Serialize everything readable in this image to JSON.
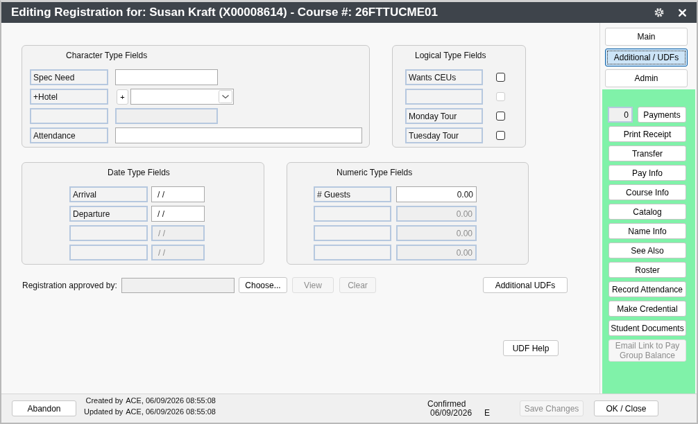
{
  "window": {
    "title": "Editing Registration for: Susan Kraft (X00008614) - Course #: 26FTTUCME01"
  },
  "groups": [
    {
      "kind": "character",
      "title": "Character Type Fields",
      "rows": [
        {
          "kind": "text",
          "label": "Spec Need",
          "disabled": false
        },
        {
          "kind": "lookup",
          "label": "+Hotel",
          "add_button": "+",
          "disabled": false
        },
        {
          "kind": "text",
          "disabled": true
        },
        {
          "kind": "long_text",
          "label": "Attendance",
          "disabled": false
        }
      ]
    },
    {
      "kind": "logical",
      "title": "Logical Type Fields",
      "rows": [
        {
          "kind": "checkbox",
          "label": "Wants CEUs",
          "checked": false,
          "disabled": false
        },
        {
          "kind": "checkbox",
          "checked": false,
          "disabled": true
        },
        {
          "kind": "checkbox",
          "label": "Monday Tour",
          "checked": false,
          "disabled": false
        },
        {
          "kind": "checkbox",
          "label": "Tuesday Tour",
          "checked": false,
          "disabled": false
        }
      ]
    },
    {
      "kind": "date",
      "title": "Date Type Fields",
      "rows": [
        {
          "kind": "date",
          "label": "Arrival",
          "value": "/ /",
          "disabled": false
        },
        {
          "kind": "date",
          "label": "Departure",
          "value": "/ /",
          "disabled": false
        },
        {
          "kind": "date",
          "value": "/ /",
          "disabled": true
        },
        {
          "kind": "date",
          "value": "/ /",
          "disabled": true
        }
      ]
    },
    {
      "kind": "numeric",
      "title": "Numeric Type Fields",
      "rows": [
        {
          "kind": "numeric",
          "label": "# Guests",
          "value": "0.00",
          "disabled": false
        },
        {
          "kind": "numeric",
          "value": "0.00",
          "disabled": true
        },
        {
          "kind": "numeric",
          "value": "0.00",
          "disabled": true
        },
        {
          "kind": "numeric",
          "value": "0.00",
          "disabled": true
        }
      ]
    }
  ],
  "approval": {
    "label": "Registration approved by:",
    "field_disabled": true,
    "buttons": [
      {
        "label": "Choose...",
        "disabled": false
      },
      {
        "label": "View",
        "disabled": true
      },
      {
        "label": "Clear",
        "disabled": true
      }
    ]
  },
  "additional_udfs_button": "Additional UDFs",
  "udf_help_button": "UDF Help",
  "side_tabs": [
    {
      "label": "Main",
      "selected": false
    },
    {
      "label": "Additional / UDFs",
      "selected": true
    },
    {
      "label": "Admin",
      "selected": false
    }
  ],
  "side_actions": {
    "payments": {
      "count": "0",
      "label": "Payments"
    },
    "buttons": [
      {
        "label": "Print Receipt",
        "disabled": false
      },
      {
        "label": "Transfer",
        "disabled": false
      },
      {
        "label": "Pay Info",
        "disabled": false
      },
      {
        "label": "Course Info",
        "disabled": false
      },
      {
        "label": "Catalog",
        "disabled": false
      },
      {
        "label": "Name Info",
        "disabled": false
      },
      {
        "label": "See Also",
        "disabled": false
      },
      {
        "label": "Roster",
        "disabled": false
      },
      {
        "label": "Record Attendance",
        "disabled": false
      },
      {
        "label": "Make Credential",
        "disabled": false
      },
      {
        "label": "Student Documents",
        "disabled": false
      },
      {
        "label": "Email Link to Pay Group Balance",
        "disabled": true
      }
    ]
  },
  "footer": {
    "abandon_button": "Abandon",
    "created": {
      "label": "Created by",
      "value": "ACE, 06/09/2026 08:55:08"
    },
    "updated": {
      "label": "Updated by",
      "value": "ACE, 06/09/2026 08:55:08"
    },
    "status": "Confirmed",
    "status_date": "06/09/2026",
    "status_code": "E",
    "save_button": {
      "label": "Save Changes",
      "disabled": true
    },
    "ok_button": "OK / Close"
  }
}
